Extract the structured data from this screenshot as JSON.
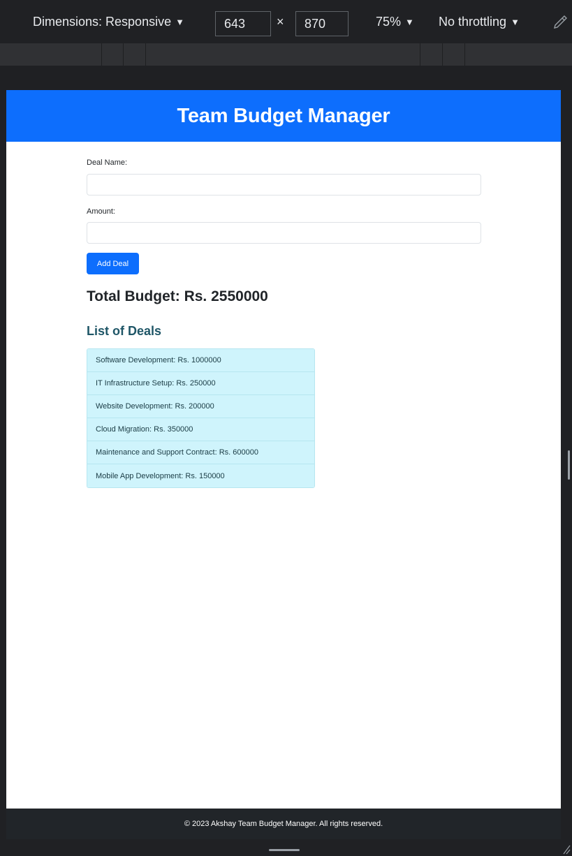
{
  "devtools": {
    "dimensions_label": "Dimensions: Responsive",
    "width_value": "643",
    "times_symbol": "×",
    "height_value": "870",
    "zoom_label": "75%",
    "throttle_label": "No throttling",
    "caret": "▼"
  },
  "app": {
    "title": "Team Budget Manager",
    "form": {
      "deal_name_label": "Deal Name:",
      "deal_name_value": "",
      "amount_label": "Amount:",
      "amount_value": "",
      "add_button_label": "Add Deal"
    },
    "total_budget_text": "Total Budget: Rs. 2550000",
    "deals_heading": "List of Deals",
    "deals": [
      "Software Development: Rs. 1000000",
      "IT Infrastructure Setup: Rs. 250000",
      "Website Development: Rs. 200000",
      "Cloud Migration: Rs. 350000",
      "Maintenance and Support Contract: Rs. 600000",
      "Mobile App Development: Rs. 150000"
    ],
    "footer_text": "© 2023 Akshay Team Budget Manager. All rights reserved."
  },
  "colors": {
    "header_blue": "#0d6efd",
    "list_background": "#cff4fc",
    "footer_background": "#212529",
    "devtools_background": "#202124"
  }
}
